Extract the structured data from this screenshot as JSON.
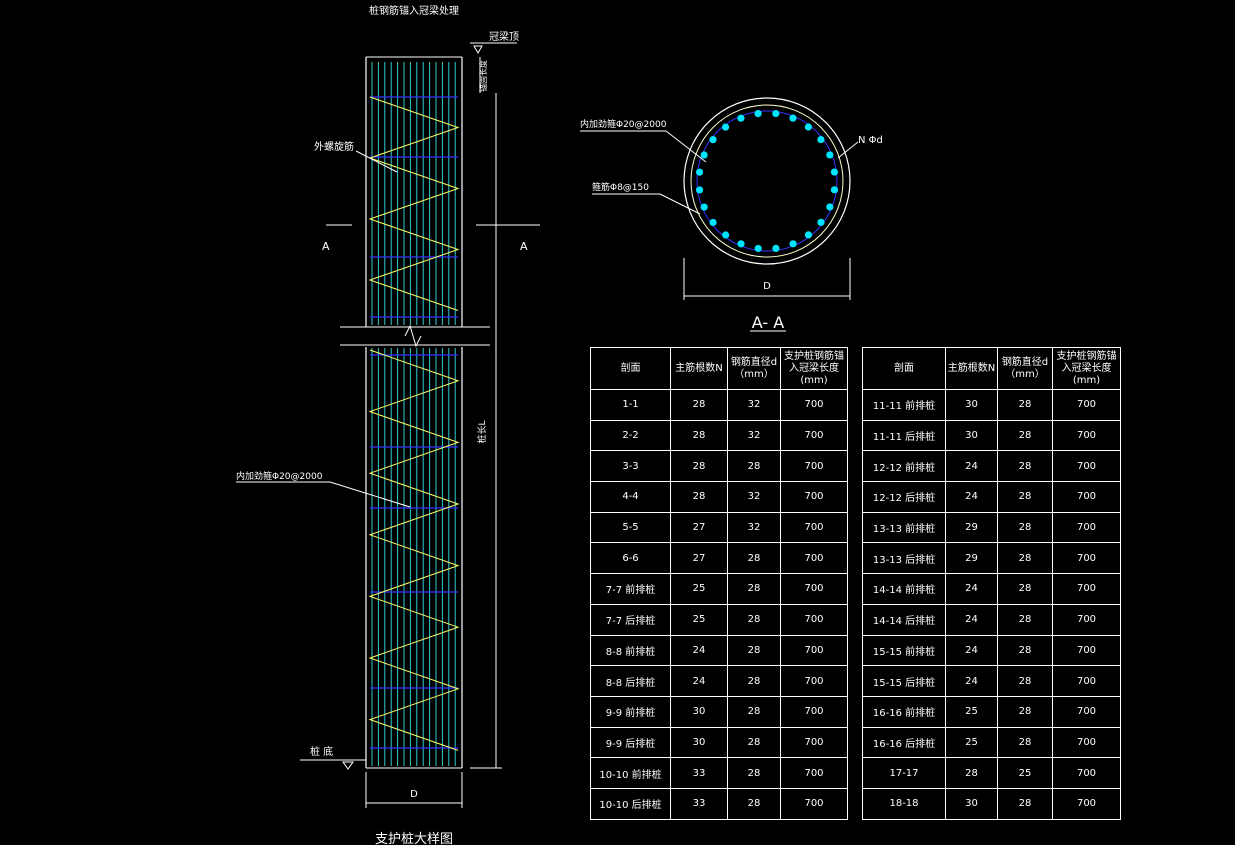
{
  "elevation": {
    "title_top": "桩钢筋锚入冠梁处理",
    "cap_top_label": "冠梁顶",
    "anchor_label": "锚固长度",
    "outer_spiral_label": "外螺旋筋",
    "inner_stirrup_label": "内加劲箍Φ20@2000",
    "section_mark_left": "A",
    "section_mark_right": "A",
    "pile_length_label": "桩长L",
    "pile_bottom_label": "桩 底",
    "diameter_label": "D",
    "caption": "支护桩大样图"
  },
  "section": {
    "inner_stirrup_label": "内加劲箍Φ20@2000",
    "bar_label": "N Φd",
    "hoop_label": "箍筋Φ8@150",
    "diameter_label": "D",
    "caption": "A- A"
  },
  "colors": {
    "background": "#000000",
    "lines": "#ffffff",
    "spiral": "#ffff66",
    "longitudinal_bars": "#33cccc",
    "stirrup": "#3333ff",
    "bar_dots": "#00e5ff",
    "outer_circle": "#ffffcc"
  },
  "table_left": {
    "headers": [
      "剖面",
      "主筋根数N",
      "钢筋直径d（mm）",
      "支护桩钢筋锚入冠梁长度(mm)"
    ],
    "rows": [
      [
        "1-1",
        "28",
        "32",
        "700"
      ],
      [
        "2-2",
        "28",
        "32",
        "700"
      ],
      [
        "3-3",
        "28",
        "28",
        "700"
      ],
      [
        "4-4",
        "28",
        "32",
        "700"
      ],
      [
        "5-5",
        "27",
        "32",
        "700"
      ],
      [
        "6-6",
        "27",
        "28",
        "700"
      ],
      [
        "7-7 前排桩",
        "25",
        "28",
        "700"
      ],
      [
        "7-7 后排桩",
        "25",
        "28",
        "700"
      ],
      [
        "8-8 前排桩",
        "24",
        "28",
        "700"
      ],
      [
        "8-8 后排桩",
        "24",
        "28",
        "700"
      ],
      [
        "9-9 前排桩",
        "30",
        "28",
        "700"
      ],
      [
        "9-9 后排桩",
        "30",
        "28",
        "700"
      ],
      [
        "10-10 前排桩",
        "33",
        "28",
        "700"
      ],
      [
        "10-10 后排桩",
        "33",
        "28",
        "700"
      ]
    ]
  },
  "table_right": {
    "headers": [
      "剖面",
      "主筋根数N",
      "钢筋直径d（mm）",
      "支护桩钢筋锚入冠梁长度(mm)"
    ],
    "rows": [
      [
        "11-11 前排桩",
        "30",
        "28",
        "700"
      ],
      [
        "11-11 后排桩",
        "30",
        "28",
        "700"
      ],
      [
        "12-12 前排桩",
        "24",
        "28",
        "700"
      ],
      [
        "12-12 后排桩",
        "24",
        "28",
        "700"
      ],
      [
        "13-13 前排桩",
        "29",
        "28",
        "700"
      ],
      [
        "13-13 后排桩",
        "29",
        "28",
        "700"
      ],
      [
        "14-14 前排桩",
        "24",
        "28",
        "700"
      ],
      [
        "14-14 后排桩",
        "24",
        "28",
        "700"
      ],
      [
        "15-15 前排桩",
        "24",
        "28",
        "700"
      ],
      [
        "15-15 后排桩",
        "24",
        "28",
        "700"
      ],
      [
        "16-16 前排桩",
        "25",
        "28",
        "700"
      ],
      [
        "16-16 后排桩",
        "25",
        "28",
        "700"
      ],
      [
        "17-17",
        "28",
        "25",
        "700"
      ],
      [
        "18-18",
        "30",
        "28",
        "700"
      ]
    ]
  }
}
